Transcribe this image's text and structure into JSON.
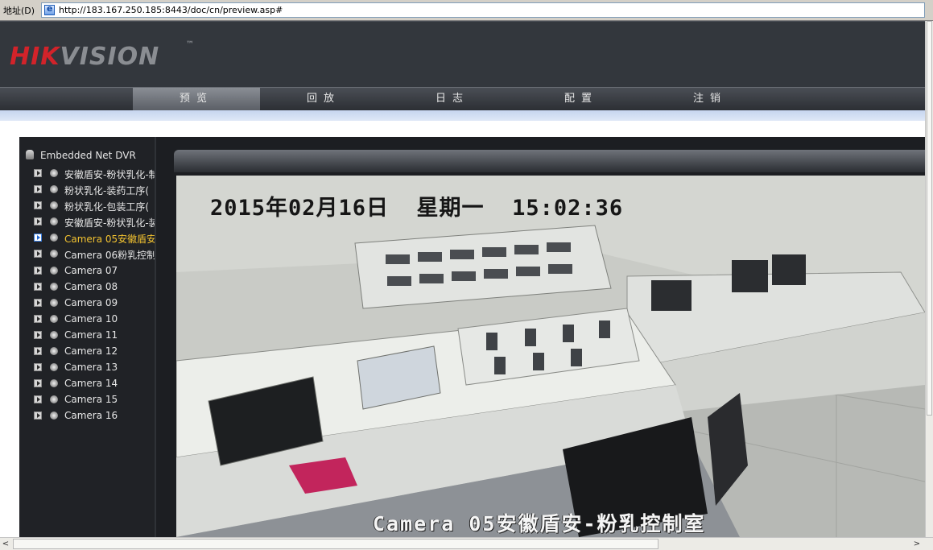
{
  "address_bar": {
    "label": "地址(D)",
    "url": "http://183.167.250.185:8443/doc/cn/preview.asp#"
  },
  "brand": {
    "logo_part1": "HIK",
    "logo_part2": "VISION",
    "trademark": "™",
    "logo_icon": "hikvision-logo",
    "accent_color": "#d2232a"
  },
  "nav": {
    "items": [
      {
        "label": "预览",
        "active": true
      },
      {
        "label": "回放",
        "active": false
      },
      {
        "label": "日志",
        "active": false
      },
      {
        "label": "配置",
        "active": false
      },
      {
        "label": "注销",
        "active": false
      }
    ]
  },
  "tree": {
    "root_label": "Embedded Net DVR",
    "root_icon": "dvr-icon",
    "items": [
      {
        "label": "安徽盾安-粉状乳化-制",
        "selected": false
      },
      {
        "label": "粉状乳化-装药工序(",
        "selected": false
      },
      {
        "label": "粉状乳化-包装工序(",
        "selected": false
      },
      {
        "label": "安徽盾安-粉状乳化-装",
        "selected": false
      },
      {
        "label": "Camera 05安徽盾安-",
        "selected": true
      },
      {
        "label": "Camera 06粉乳控制",
        "selected": false
      },
      {
        "label": "Camera 07",
        "selected": false
      },
      {
        "label": "Camera 08",
        "selected": false
      },
      {
        "label": "Camera 09",
        "selected": false
      },
      {
        "label": "Camera 10",
        "selected": false
      },
      {
        "label": "Camera 11",
        "selected": false
      },
      {
        "label": "Camera 12",
        "selected": false
      },
      {
        "label": "Camera 13",
        "selected": false
      },
      {
        "label": "Camera 14",
        "selected": false
      },
      {
        "label": "Camera 15",
        "selected": false
      },
      {
        "label": "Camera 16",
        "selected": false
      }
    ]
  },
  "video": {
    "osd_timestamp": "2015年02月16日  星期一  15:02:36",
    "osd_camera_name": "Camera 05安徽盾安-粉乳控制室"
  }
}
